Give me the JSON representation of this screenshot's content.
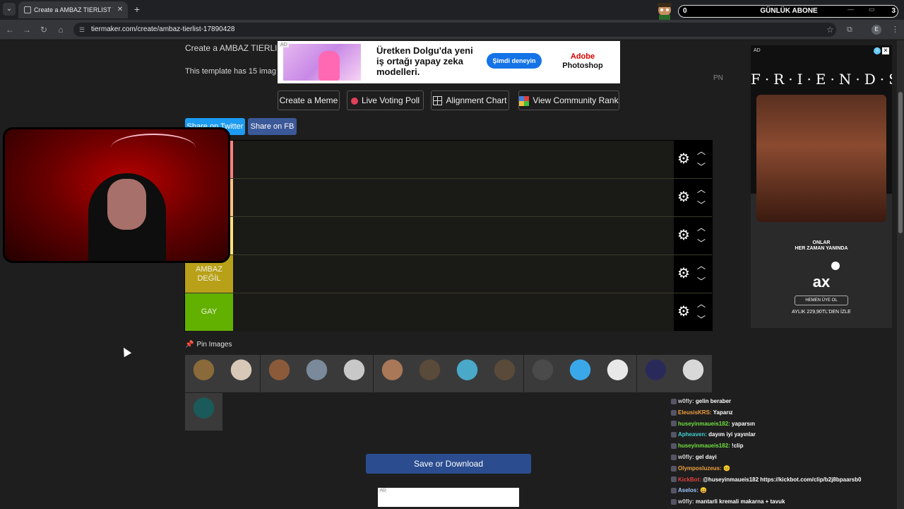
{
  "browser": {
    "tab_title": "Create a AMBAZ TIERLIST Tier List",
    "tab_close": "✕",
    "new_tab": "+",
    "url": "tiermaker.com/create/ambaz-tierlist-17890428",
    "profile_initial": "E",
    "icons": [
      "back-icon",
      "forward-icon",
      "reload-icon",
      "home-icon",
      "site-info-icon",
      "bookmark-star-icon",
      "extensions-icon",
      "menu-icon"
    ]
  },
  "overlay": {
    "subscriber_count": "0",
    "subscriber_label": "GÜNLÜK ABONE",
    "subscriber_goal": "3"
  },
  "page": {
    "heading": "Create a AMBAZ TIERLIST",
    "template_note": "This template has 15 imag",
    "pn_label": "PN",
    "buttons": {
      "create_meme": "Create a Meme",
      "live_voting": "Live Voting Poll",
      "alignment_chart": "Alignment Chart",
      "community_rank": "View Community Rank"
    },
    "share": {
      "twitter": "Share on Twitter",
      "fb": "Share on FB"
    },
    "tiers": [
      {
        "label": "",
        "color": "#ff7f7f"
      },
      {
        "label": "",
        "color": "#ffbf7f"
      },
      {
        "label": "",
        "color": "#ffdf7f"
      },
      {
        "label": "AMBAZ DEĞİL",
        "color": "#b8a018"
      },
      {
        "label": "GAY",
        "color": "#62b000"
      }
    ],
    "pin_label": "Pin Images",
    "save_button": "Save or Download",
    "avatars": [
      {
        "name": "avatar-1",
        "color": "#8a6a3a"
      },
      {
        "name": "avatar-2",
        "color": "#d8c8b8"
      },
      {
        "name": "avatar-3",
        "color": "#8a5a3a"
      },
      {
        "name": "avatar-4",
        "color": "#7a8a9a"
      },
      {
        "name": "avatar-5",
        "color": "#c8c8c8"
      },
      {
        "name": "avatar-6",
        "color": "#a87858"
      },
      {
        "name": "avatar-7",
        "color": "#5a4a3a"
      },
      {
        "name": "avatar-8",
        "color": "#4aa8c8"
      },
      {
        "name": "avatar-9",
        "color": "#5a4a3a"
      },
      {
        "name": "avatar-10",
        "color": "#4a4a4a"
      },
      {
        "name": "avatar-11",
        "color": "#3aa8e8"
      },
      {
        "name": "avatar-12",
        "color": "#e8e8e8"
      },
      {
        "name": "avatar-13",
        "color": "#2a2a5a"
      },
      {
        "name": "avatar-14",
        "color": "#d8d8d8"
      },
      {
        "name": "avatar-15",
        "color": "#1a5a5a"
      }
    ]
  },
  "ad_banner": {
    "tag": "AD",
    "text": "Üretken Dolgu'da yeni iş ortağı yapay zeka modelleri.",
    "cta": "Şimdi deneyin",
    "brand_line1": "Adobe",
    "brand_line2": "Photoshop"
  },
  "side_ad": {
    "tag": "AD",
    "title": "F·R·I·E·N·D·S",
    "line1": "ONLAR",
    "line2": "HER ZAMAN YANINDA",
    "logo": "ax",
    "cta": "HEMEN ÜYE OL",
    "price": "AYLIK 229,90TL'DEN İZLE"
  },
  "bottom_ad_tag": "AD",
  "chat": [
    {
      "user": "w0fly:",
      "msg": "gelin beraber",
      "color": "#d0d0d0"
    },
    {
      "user": "EleusisKRS:",
      "msg": "Yaparız",
      "color": "#f0a040"
    },
    {
      "user": "huseyinmaueis182:",
      "msg": "yaparsın",
      "color": "#70e040"
    },
    {
      "user": "Apheaven:",
      "msg": "dayım iyi yayınlar",
      "color": "#40d0d0"
    },
    {
      "user": "huseyinmaueis182:",
      "msg": "!clip",
      "color": "#70e040"
    },
    {
      "user": "w0fly:",
      "msg": "gel dayi",
      "color": "#d0d0d0"
    },
    {
      "user": "Olymposluzeus:",
      "msg": "😐",
      "color": "#f0a040"
    },
    {
      "user": "KickBot:",
      "msg": "@huseyinmaueis182 https://kickbot.com/clip/b2j8bpaarsb0",
      "color": "#e04040"
    },
    {
      "user": "Aselos:",
      "msg": "😄",
      "color": "#a0c8ff"
    },
    {
      "user": "w0fly:",
      "msg": "mantarli kremali makarna + tavuk",
      "color": "#d0d0d0"
    }
  ]
}
